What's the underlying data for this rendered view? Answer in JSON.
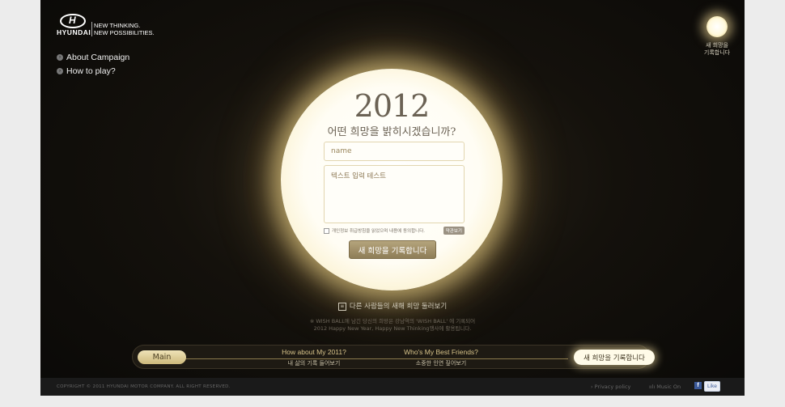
{
  "logo": {
    "wordmark": "HYUNDAI",
    "tagline_1": "NEW THINKING.",
    "tagline_2": "NEW POSSIBILITIES."
  },
  "leftnav": {
    "items": [
      {
        "label": "About Campaign"
      },
      {
        "label": "How to play?"
      }
    ]
  },
  "miniball": {
    "line_1": "새 희망을",
    "line_2": "기록합니다"
  },
  "ball": {
    "year": "2012",
    "question": "어떤 희망을 밝히시겠습니까?",
    "name_placeholder": "name",
    "message_value": "텍스트 입력 테스트",
    "agree_label": "개인정보 취급방침을 읽었으며 내용에 동의합니다.",
    "terms_button": "약관보기",
    "submit_label": "새 희망을 기록합니다"
  },
  "browse": {
    "label": "다른 사람들의 새해 희망 둘러보기"
  },
  "note": {
    "line_1": "※ WISH BALL에 남긴 당신의 희망은 강남역의 'WISH BALL' 에 기록되어",
    "line_2": "2012 Happy New Year, Happy New Thinking행사에 활용됩니다."
  },
  "bottomnav": {
    "main_label": "Main",
    "items": [
      {
        "title": "How about My 2011?",
        "sub": "내 삶의 기록 들어보기"
      },
      {
        "title": "Who's My Best Friends?",
        "sub": "소중한 인연 짚어보기"
      }
    ],
    "wish_label": "새 희망을 기록합니다"
  },
  "footer": {
    "copyright": "COPYRIGHT © 2011 HYUNDAI MOTOR COMPANY.  ALL RIGHT RESERVED.",
    "privacy": "› Privacy policy",
    "music": "ıılı Music On",
    "fb_label": "f",
    "like_label": "Like"
  },
  "colors": {
    "stage": "#0a0907",
    "ball_highlight": "#fffdf4",
    "gold": "#d7c38a",
    "submit": "#8e7d57"
  }
}
